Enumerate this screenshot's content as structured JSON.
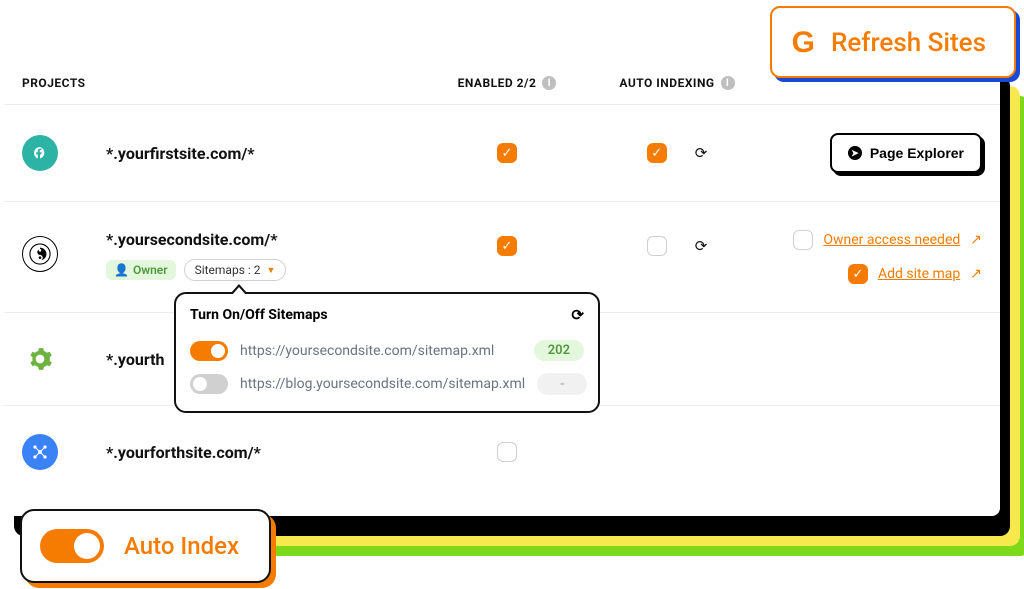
{
  "header": {
    "projects": "Projects",
    "enabled": "Enabled 2/2",
    "auto_indexing": "Auto Indexing"
  },
  "refresh_card": {
    "label": "Refresh Sites",
    "logo": "G"
  },
  "auto_card": {
    "label": "Auto Index"
  },
  "page_explorer": {
    "label": "Page Explorer"
  },
  "rows": [
    {
      "site": "*.yourfirstsite.com/*"
    },
    {
      "site": "*.yoursecondsite.com/*",
      "owner_label": "Owner",
      "sitemaps_label": "Sitemaps : 2",
      "owner_access": "Owner access needed",
      "add_sitemap": "Add site map"
    },
    {
      "site": "*.yourthirdsite.com/*",
      "site_truncated": "*.yourth"
    },
    {
      "site": "*.yourforthsite.com/*"
    }
  ],
  "popover": {
    "title": "Turn On/Off Sitemaps",
    "items": [
      {
        "url": "https://yoursecondsite.com/sitemap.xml",
        "count": "202",
        "on": true
      },
      {
        "url": "https://blog.yoursecondsite.com/sitemap.xml",
        "count": "-",
        "on": false
      }
    ]
  }
}
